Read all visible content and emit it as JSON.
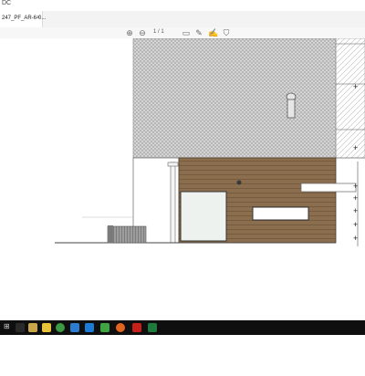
{
  "window": {
    "title": "DC"
  },
  "tab": {
    "label": "247_PF_AR-6-0...",
    "close_label": "×"
  },
  "toolbar": {
    "page_current": "1",
    "page_total": "/ 1",
    "icons": [
      "arrow-up-icon",
      "arrow-down-icon",
      "comment-icon",
      "pen-icon",
      "sign-icon",
      "stamp-icon"
    ]
  },
  "drawing": {
    "dimension_marks": [
      "+",
      "+",
      "+",
      "+",
      "+",
      "+",
      "+"
    ]
  },
  "taskbar": {
    "icons": [
      "start-icon",
      "search-icon",
      "task-view-icon",
      "file-explorer-icon",
      "chrome-icon",
      "edge-icon",
      "dropbox-icon",
      "app-icon",
      "firefox-icon",
      "acrobat-icon",
      "excel-icon"
    ]
  },
  "colors": {
    "roof": "#bdbdbd",
    "wood": "#8b6e4e",
    "wall": "#ffffff",
    "window_fill": "#eef2ef",
    "taskbar": "#0f0f0f"
  }
}
